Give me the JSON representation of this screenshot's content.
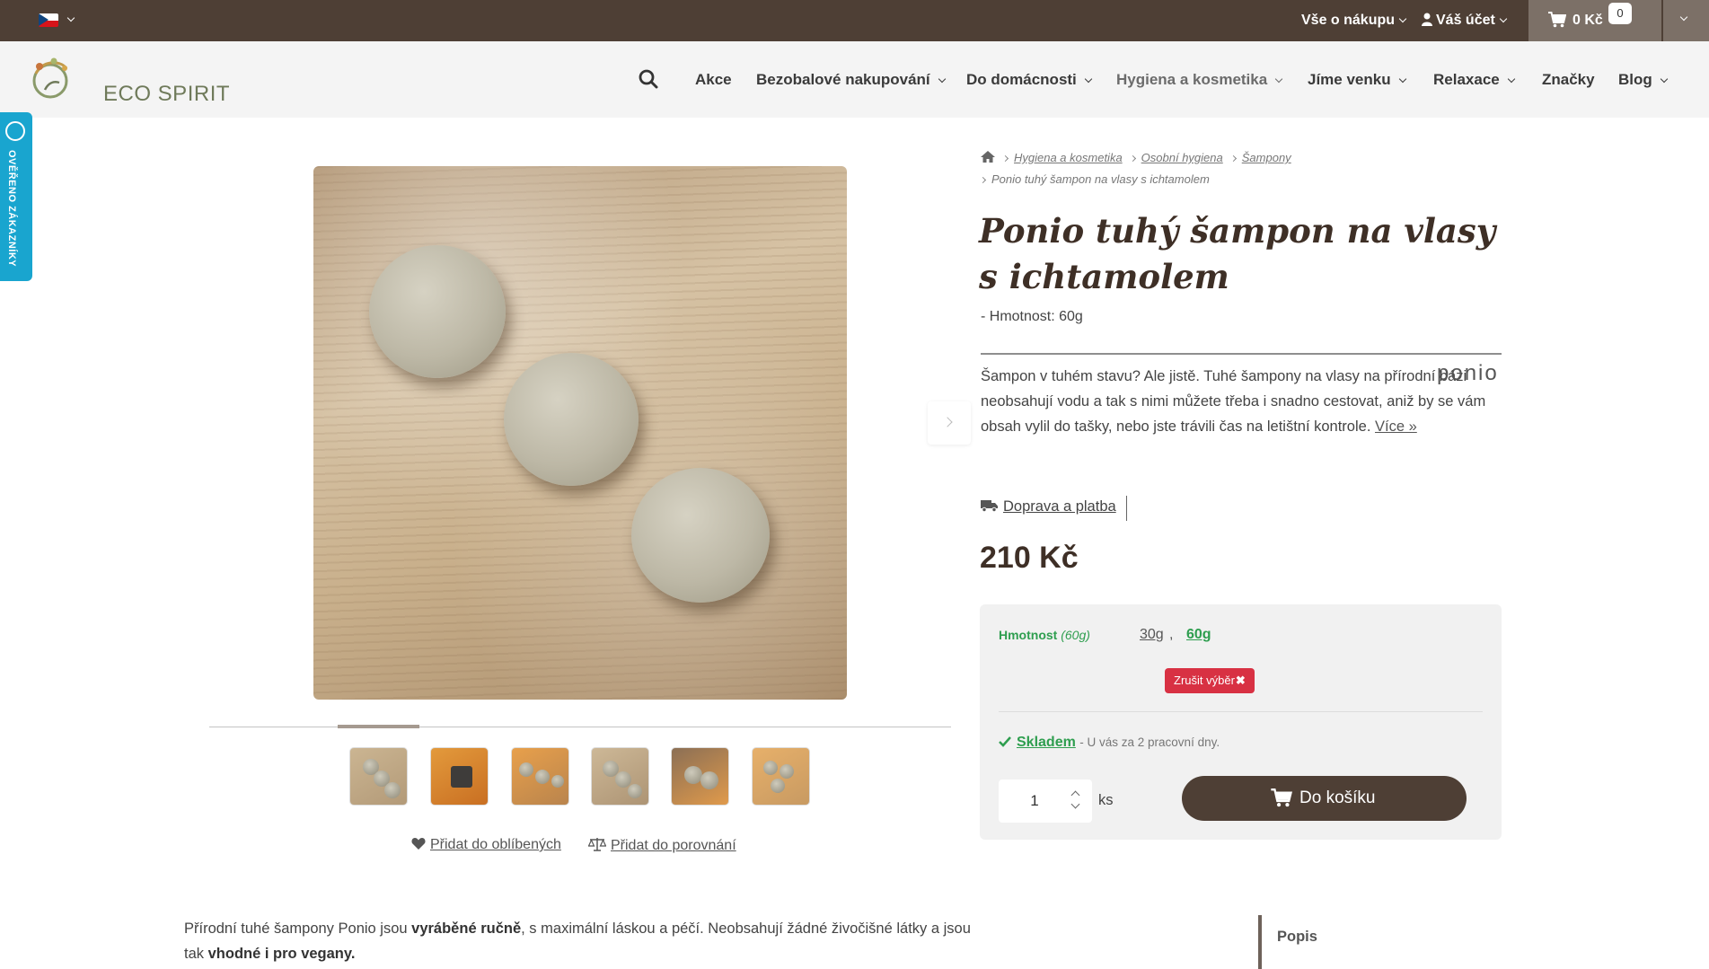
{
  "topbar": {
    "language": "cs",
    "shopping_info": "Vše o nákupu",
    "account": "Váš účet",
    "cart_total": "0 Kč",
    "cart_count": "0"
  },
  "header": {
    "logo_text": "ECO SPIRIT",
    "nav": [
      {
        "label": "Akce"
      },
      {
        "label": "Bezobalové nakupování"
      },
      {
        "label": "Do domácnosti"
      },
      {
        "label": "Hygiena a kosmetika"
      },
      {
        "label": "Jíme venku"
      },
      {
        "label": "Relaxace"
      },
      {
        "label": "Značky"
      },
      {
        "label": "Blog"
      }
    ]
  },
  "verified_badge": "OVĚŘENO ZÁKAZNÍKY",
  "breadcrumb": {
    "items": [
      "Hygiena a kosmetika",
      "Osobní hygiena",
      "Šampony"
    ],
    "current": "Ponio tuhý šampon na vlasy s ichtamolem"
  },
  "product": {
    "title": "Ponio tuhý šampon na vlasy s ichtamolem",
    "weight_note": "- Hmotnost: 60g",
    "brand": "ponio",
    "description": "Šampon v tuhém stavu? Ale jistě. Tuhé šampony na vlasy na přírodní bázi neobsahují vodu a tak s nimi můžete třeba i snadno cestovat, aniž by se vám obsah vylil do tašky, nebo jste trávili čas na letištní kontrole.",
    "more_link": "Více",
    "shipping_link": "Doprava a platba",
    "price": "210 Kč"
  },
  "variants": {
    "label": "Hmotnost",
    "selected_hint": "(60g)",
    "options": [
      "30g",
      "60g"
    ],
    "separator": ",",
    "reset_label": "Zrušit výběr"
  },
  "stock": {
    "status": "Skladem",
    "note": "- U vás za 2 pracovní dny."
  },
  "purchase": {
    "quantity": "1",
    "unit": "ks",
    "add_to_cart": "Do košíku"
  },
  "gallery": {
    "favorite_link": "Přidat do oblíbených",
    "compare_link": "Přidat do porovnání",
    "thumbnail_count": 6
  },
  "lower": {
    "intro_part1": "Přírodní tuhé šampony Ponio jsou ",
    "intro_bold1": "vyráběné ručně",
    "intro_part2": ", s maximální láskou a péčí. Neobsahují žádné živočišné látky a jsou tak ",
    "intro_bold2": "vhodné i pro vegany.",
    "side_menu_label": "Popis"
  },
  "colors": {
    "topbar": "#4e3f35",
    "accent_green": "#2e9e4f",
    "reset_red": "#d83143",
    "verified_blue": "#19a5cf"
  }
}
